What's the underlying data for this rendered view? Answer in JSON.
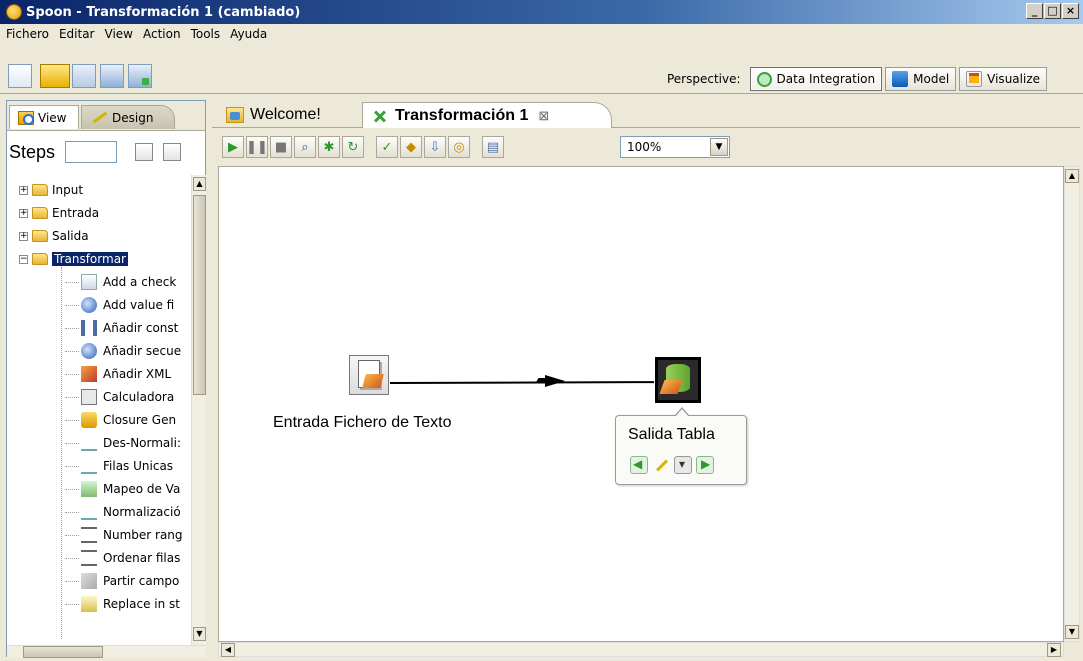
{
  "window": {
    "title": "Spoon - Transformación 1 (cambiado)",
    "controls": [
      "_",
      "□",
      "×"
    ]
  },
  "menubar": [
    "Fichero",
    "Editar",
    "View",
    "Action",
    "Tools",
    "Ayuda"
  ],
  "perspective": {
    "label": "Perspective:",
    "options": [
      {
        "label": "Data Integration",
        "active": true,
        "icon": "data-integration-icon"
      },
      {
        "label": "Model",
        "active": false,
        "icon": "model-icon"
      },
      {
        "label": "Visualize",
        "active": false,
        "icon": "visualize-icon"
      }
    ]
  },
  "left_panel": {
    "tabs": {
      "view": "View",
      "design": "Design"
    },
    "steps_label": "Steps",
    "steps_search_value": "",
    "categories": [
      {
        "label": "Input",
        "expanded": false
      },
      {
        "label": "Entrada",
        "expanded": false
      },
      {
        "label": "Salida",
        "expanded": false
      },
      {
        "label": "Transformar",
        "expanded": true,
        "selected": true
      }
    ],
    "transform_steps": [
      "Add a check",
      "Add value fi",
      "Añadir const",
      "Añadir secue",
      "Añadir XML",
      "Calculadora",
      "Closure Gen",
      "Des-Normali:",
      "Filas Unicas",
      "Mapeo de Va",
      "Normalizació",
      "Number rang",
      "Ordenar filas",
      "Partir campo",
      "Replace in st"
    ]
  },
  "editor": {
    "tabs": [
      {
        "label": "Welcome!",
        "active": false
      },
      {
        "label": "Transformación 1",
        "active": true,
        "close": "⊠"
      }
    ],
    "zoom": "100%",
    "canvas": {
      "steps": [
        {
          "label": "Entrada Fichero de Texto"
        },
        {
          "label": "Salida Tabla"
        }
      ],
      "popup_title": "Salida Tabla"
    }
  },
  "colors": {
    "title_bar": "#0a246a",
    "selection": "#0a246a",
    "canvas": "#ffffff",
    "chrome": "#ece9d8"
  }
}
